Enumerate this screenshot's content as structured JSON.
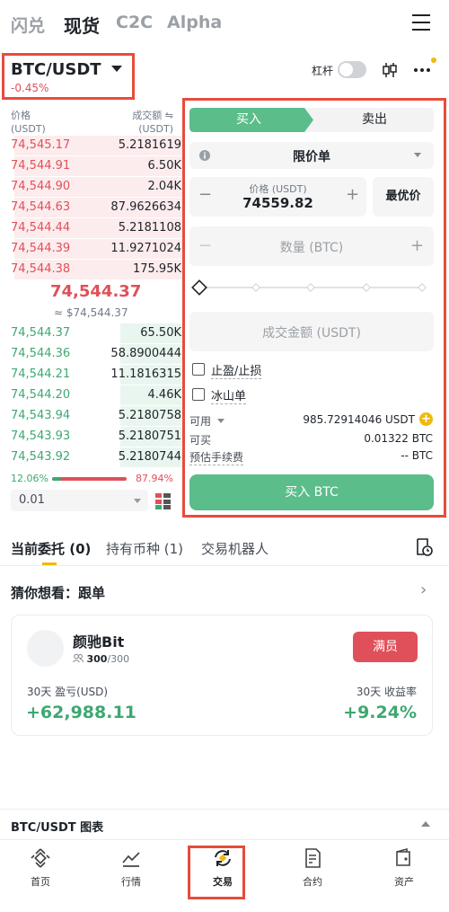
{
  "top_tabs": [
    "闪兑",
    "现货",
    "C2C",
    "Alpha"
  ],
  "pair": {
    "name": "BTC/USDT",
    "change": "-0.45%"
  },
  "leverage_label": "杠杆",
  "orderbook": {
    "price_header": "价格",
    "price_unit": "(USDT)",
    "amount_header": "成交额",
    "amount_unit": "(USDT)",
    "asks": [
      {
        "price": "74,545.17",
        "amount": "5.2181619",
        "depth": 0.98
      },
      {
        "price": "74,544.91",
        "amount": "6.50K",
        "depth": 0.98
      },
      {
        "price": "74,544.90",
        "amount": "2.04K",
        "depth": 0.98
      },
      {
        "price": "74,544.63",
        "amount": "87.9626634",
        "depth": 0.98
      },
      {
        "price": "74,544.44",
        "amount": "5.2181108",
        "depth": 0.98
      },
      {
        "price": "74,544.39",
        "amount": "11.9271024",
        "depth": 0.98
      },
      {
        "price": "74,544.38",
        "amount": "175.95K",
        "depth": 0.98
      }
    ],
    "last_price": "74,544.37",
    "last_price_fiat": "≈ $74,544.37",
    "bids": [
      {
        "price": "74,544.37",
        "amount": "65.50K",
        "depth": 0.37
      },
      {
        "price": "74,544.36",
        "amount": "58.8900444",
        "depth": 0.37
      },
      {
        "price": "74,544.21",
        "amount": "11.1816315",
        "depth": 0.37
      },
      {
        "price": "74,544.20",
        "amount": "4.46K",
        "depth": 0.37
      },
      {
        "price": "74,543.94",
        "amount": "5.2180758",
        "depth": 0.37
      },
      {
        "price": "74,543.93",
        "amount": "5.2180751",
        "depth": 0.37
      },
      {
        "price": "74,543.92",
        "amount": "5.2180744",
        "depth": 0.37
      }
    ],
    "buy_ratio": "12.06%",
    "sell_ratio": "87.94%",
    "buy_fraction": 0.1206,
    "precision": "0.01"
  },
  "form": {
    "buy_tab": "买入",
    "sell_tab": "卖出",
    "order_type": "限价单",
    "price_label": "价格 (USDT)",
    "price_value": "74559.82",
    "best_price": "最优价",
    "qty_placeholder": "数量 (BTC)",
    "total_placeholder": "成交金额 (USDT)",
    "tp_sl": "止盈/止损",
    "iceberg": "冰山单",
    "available_label": "可用",
    "available_value": "985.72914046 USDT",
    "can_buy_label": "可买",
    "can_buy_value": "0.01322 BTC",
    "fee_label": "预估手续费",
    "fee_value": "-- BTC",
    "submit": "买入 BTC"
  },
  "orders_tabs": [
    "当前委托 (0)",
    "持有币种 (1)",
    "交易机器人"
  ],
  "guess": {
    "title": "猜你想看：跟单"
  },
  "copy_card": {
    "name": "颜驰Bit",
    "followers": "300",
    "max_followers": "/300",
    "full_label": "满员",
    "pnl_label": "30天 盈亏(USD)",
    "pnl_value": "+62,988.11",
    "roi_label": "30天 收益率",
    "roi_value": "+9.24%"
  },
  "chart_bar": "BTC/USDT 图表",
  "bottom_nav": [
    "首页",
    "行情",
    "交易",
    "合约",
    "资产"
  ],
  "colors": {
    "green": "#3ea872",
    "red": "#e0505a",
    "highlight": "#e74c3c"
  }
}
